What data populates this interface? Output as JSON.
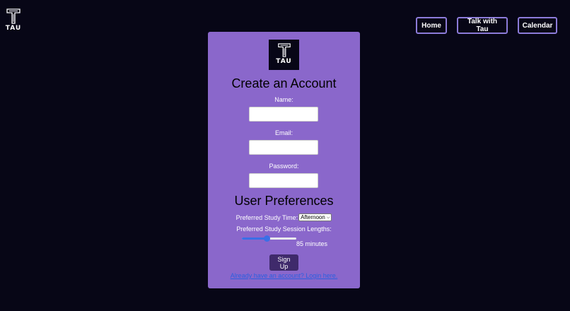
{
  "brand": {
    "name": "TAU"
  },
  "nav": {
    "items": [
      {
        "label": "Home"
      },
      {
        "label": "Talk with Tau"
      },
      {
        "label": "Calendar"
      }
    ]
  },
  "form": {
    "logo_text": "TAU",
    "title": "Create an Account",
    "name_label": "Name:",
    "name_value": "",
    "email_label": "Email:",
    "email_value": "",
    "password_label": "Password:",
    "password_value": "",
    "preferences_title": "User Preferences",
    "study_time_label": "Preferred Study Time:",
    "study_time_selected": "Afternoon",
    "session_length_label": "Preferred Study Session Lengths:",
    "session_length_percent": 45,
    "session_length_value": "85 minutes",
    "signup_label": "Sign Up",
    "login_link": "Already have an account? Login here."
  },
  "colors": {
    "background": "#070616",
    "card": "#8a67cb",
    "button": "#3f2a6b",
    "link": "#2b5fe0",
    "slider": "#3b6fe6"
  },
  "icons": {
    "corner_logo": "tau-logo-icon",
    "card_logo": "tau-logo-icon"
  }
}
